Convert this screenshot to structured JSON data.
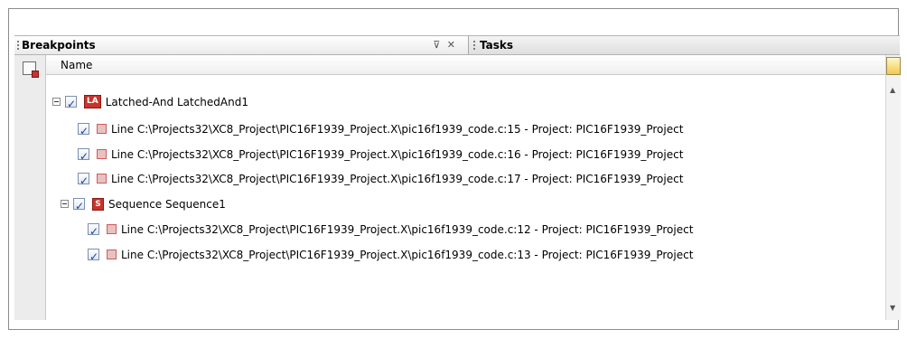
{
  "tabs": [
    {
      "label": "Breakpoints",
      "active": true
    },
    {
      "label": "Tasks",
      "active": false
    }
  ],
  "tab_icons": [
    "restore-icon",
    "close-icon"
  ],
  "table": {
    "column_header": "Name"
  },
  "groups": [
    {
      "label": "Latched-And LatchedAnd1",
      "icon_text": "LA",
      "checked": true,
      "items": [
        {
          "label": "Line C:\\Projects32\\XC8_Project\\PIC16F1939_Project.X\\pic16f1939_code.c:15 - Project: PIC16F1939_Project",
          "checked": true
        },
        {
          "label": "Line C:\\Projects32\\XC8_Project\\PIC16F1939_Project.X\\pic16f1939_code.c:16 - Project: PIC16F1939_Project",
          "checked": true
        },
        {
          "label": "Line C:\\Projects32\\XC8_Project\\PIC16F1939_Project.X\\pic16f1939_code.c:17 - Project: PIC16F1939_Project",
          "checked": true
        }
      ]
    },
    {
      "label": "Sequence Sequence1",
      "icon_text": "S",
      "checked": true,
      "items": [
        {
          "label": "Line C:\\Projects32\\XC8_Project\\PIC16F1939_Project.X\\pic16f1939_code.c:12 - Project: PIC16F1939_Project",
          "checked": true
        },
        {
          "label": "Line C:\\Projects32\\XC8_Project\\PIC16F1939_Project.X\\pic16f1939_code.c:13 - Project: PIC16F1939_Project",
          "checked": true
        }
      ]
    }
  ],
  "colors": {
    "breakpoint_fill": "#e7c2c2",
    "group_icon": "#c8332b"
  }
}
